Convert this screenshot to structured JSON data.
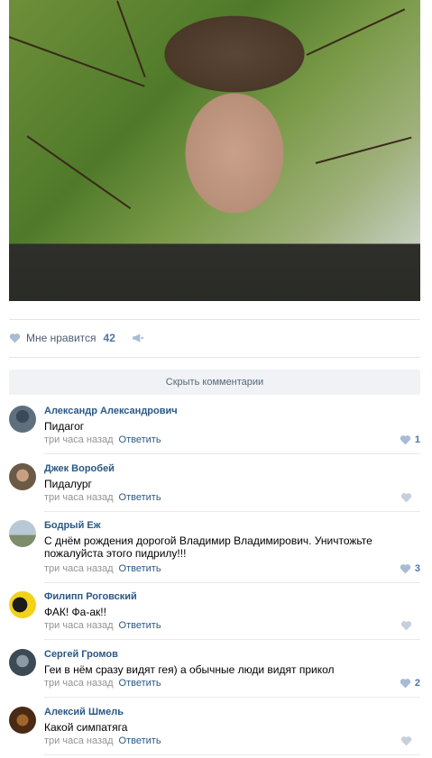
{
  "post": {
    "likes_label": "Мне нравится",
    "likes_count": "42",
    "hide_comments_label": "Скрыть комментарии"
  },
  "comments": [
    {
      "author": "Александр Александрович",
      "text": "Пидагог",
      "time": "три часа назад",
      "reply": "Ответить",
      "likes": "1"
    },
    {
      "author": "Джек Воробей",
      "text": "Пидалург",
      "time": "три часа назад",
      "reply": "Ответить",
      "likes": ""
    },
    {
      "author": "Бодрый Еж",
      "text": "С днём рождения дорогой Владимир Владимирович. Уничтожьте пожалуйста этого пидрилу!!!",
      "time": "три часа назад",
      "reply": "Ответить",
      "likes": "3"
    },
    {
      "author": "Филипп Роговский",
      "text": "ФАК! Фа-ак!!",
      "time": "три часа назад",
      "reply": "Ответить",
      "likes": ""
    },
    {
      "author": "Сергей Громов",
      "text": "Геи в нём сразу видят гея) а обычные люди видят прикол",
      "time": "три часа назад",
      "reply": "Ответить",
      "likes": "2"
    },
    {
      "author": "Алексий Шмель",
      "text": "Какой симпатяга",
      "time": "три часа назад",
      "reply": "Ответить",
      "likes": ""
    }
  ],
  "colors": {
    "link": "#2a5885",
    "meta": "#939393",
    "heart": "#a7bcd3",
    "button_bg": "#f0f2f5"
  }
}
